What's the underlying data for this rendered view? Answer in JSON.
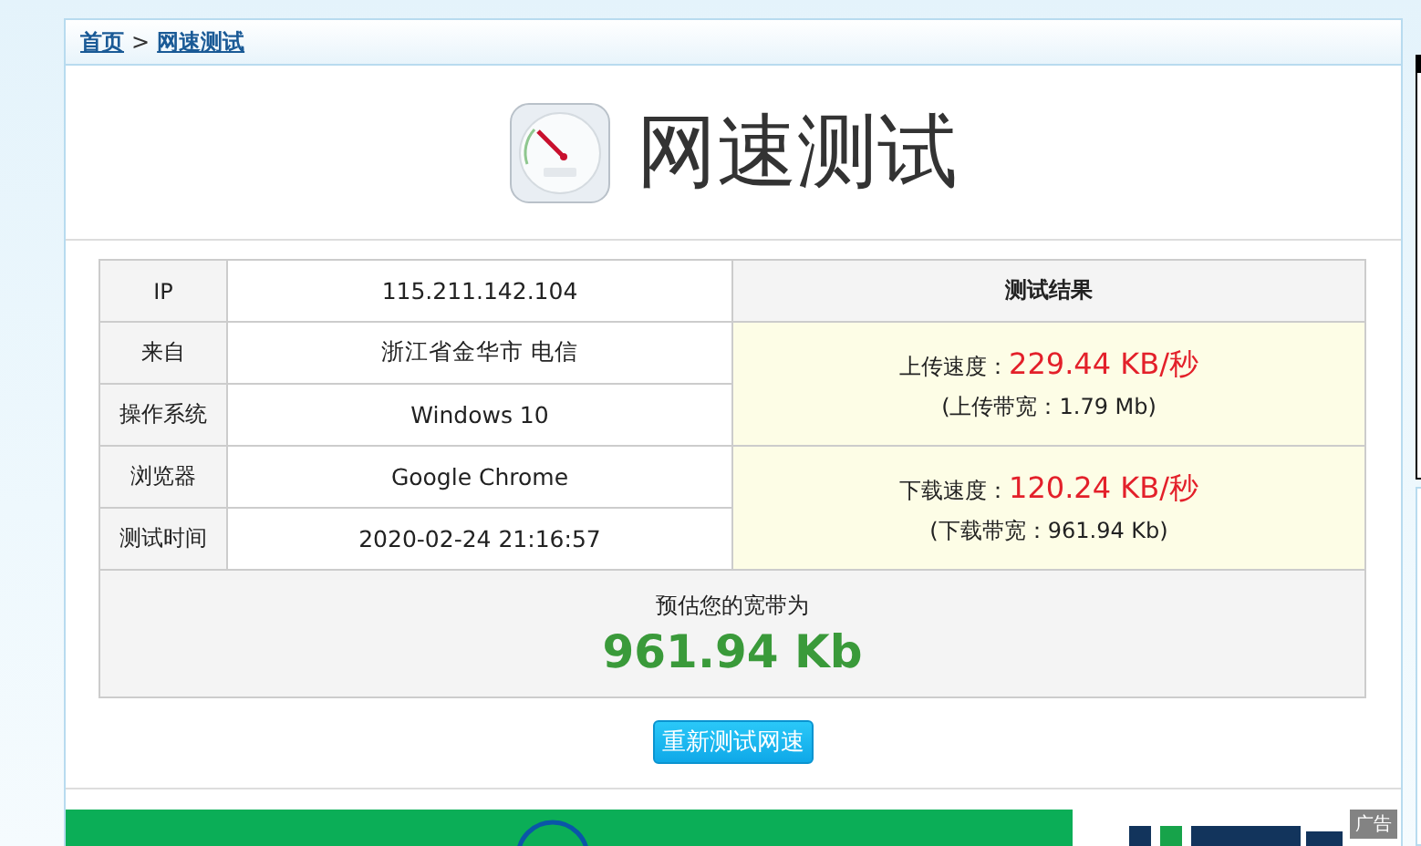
{
  "breadcrumb": {
    "items": [
      "首页",
      "网速测试"
    ],
    "separator": ">"
  },
  "header": {
    "title": "网速测试"
  },
  "info_rows": [
    {
      "label": "IP",
      "value": "115.211.142.104"
    },
    {
      "label": "来自",
      "value": "浙江省金华市 电信"
    },
    {
      "label": "操作系统",
      "value": "Windows 10"
    },
    {
      "label": "浏览器",
      "value": "Google Chrome"
    },
    {
      "label": "测试时间",
      "value": "2020-02-24 21:16:57"
    }
  ],
  "results": {
    "heading": "测试结果",
    "items": [
      {
        "label": "上传速度：",
        "speed": "229.44 KB/秒",
        "bandwidth": "(上传带宽：1.79 Mb)"
      },
      {
        "label": "下载速度：",
        "speed": "120.24 KB/秒",
        "bandwidth": "(下载带宽：961.94 Kb)"
      }
    ]
  },
  "summary": {
    "caption": "预估您的宽带为",
    "value": "961.94 Kb"
  },
  "button": {
    "label": "重新测试网速"
  },
  "ad": {
    "kind": "picture",
    "badge": "广告"
  }
}
